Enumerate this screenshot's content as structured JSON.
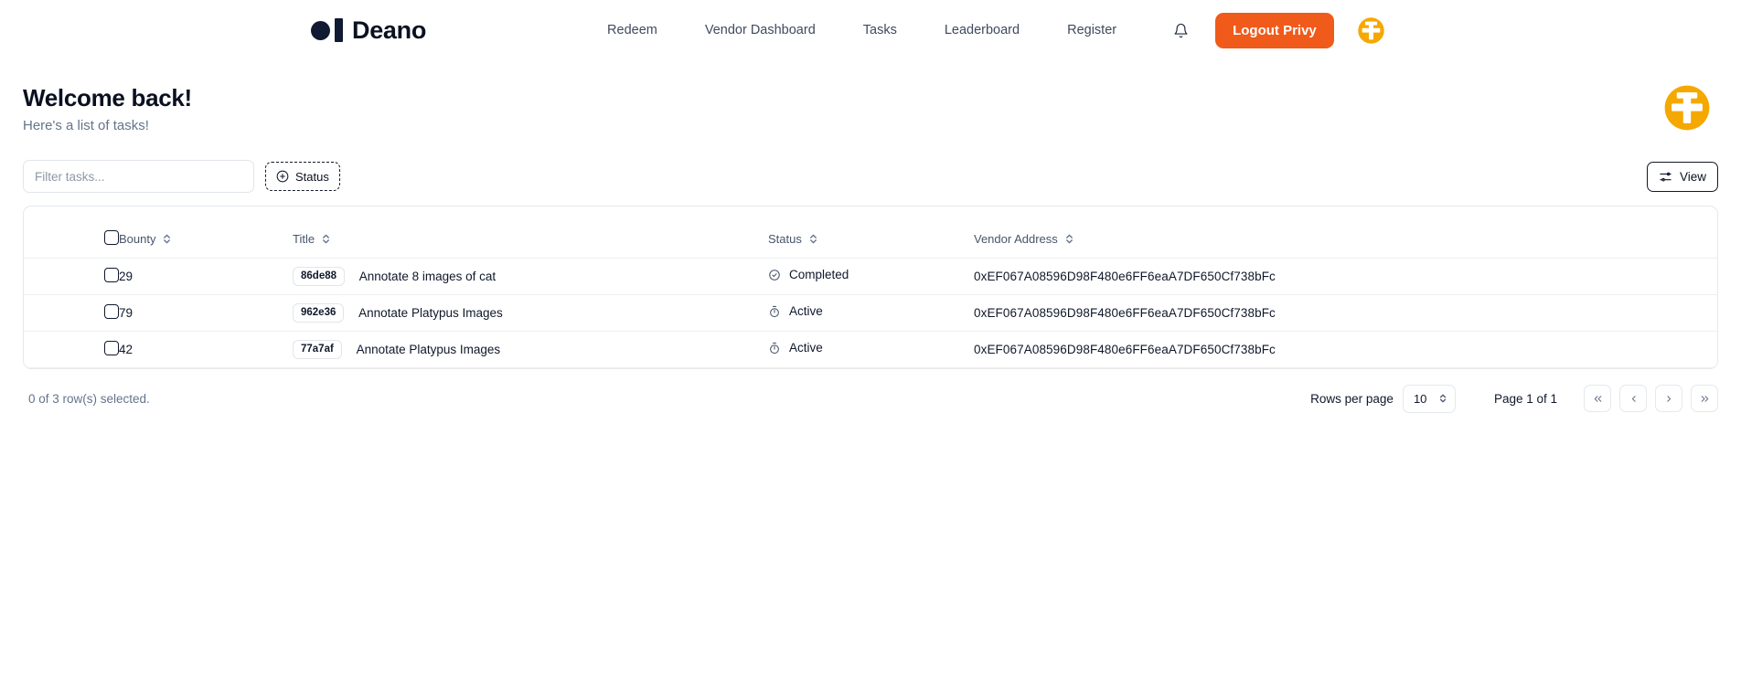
{
  "brand": {
    "name": "Deano"
  },
  "nav": {
    "links": [
      {
        "label": "Redeem"
      },
      {
        "label": "Vendor Dashboard"
      },
      {
        "label": "Tasks"
      },
      {
        "label": "Leaderboard"
      },
      {
        "label": "Register"
      }
    ],
    "logout_label": "Logout Privy",
    "bell_icon": "bell-icon",
    "logo_icon": "anchor-circle-logo"
  },
  "colors": {
    "accent_orange": "#f05a1a",
    "logo_gold": "#f5a800",
    "brand_dark": "#111a33",
    "muted": "#64748b",
    "border": "#e6e8ec"
  },
  "page": {
    "title": "Welcome back!",
    "subtitle": "Here's a list of tasks!"
  },
  "toolbar": {
    "filter_placeholder": "Filter tasks...",
    "filter_value": "",
    "status_label": "Status",
    "status_icon": "plus-circle-icon",
    "view_label": "View",
    "view_icon": "sliders-icon"
  },
  "table": {
    "columns": [
      {
        "key": "bounty",
        "label": "Bounty"
      },
      {
        "key": "title",
        "label": "Title"
      },
      {
        "key": "status",
        "label": "Status"
      },
      {
        "key": "vendor",
        "label": "Vendor Address"
      }
    ],
    "rows": [
      {
        "selected": false,
        "bounty": "29",
        "badge": "86de88",
        "title": "Annotate 8 images of cat",
        "status": "Completed",
        "status_icon": "check-circle-icon",
        "vendor": "0xEF067A08596D98F480e6FF6eaA7DF650Cf738bFc"
      },
      {
        "selected": false,
        "bounty": "79",
        "badge": "962e36",
        "title": "Annotate Platypus Images",
        "status": "Active",
        "status_icon": "timer-icon",
        "vendor": "0xEF067A08596D98F480e6FF6eaA7DF650Cf738bFc"
      },
      {
        "selected": false,
        "bounty": "42",
        "badge": "77a7af",
        "title": "Annotate Platypus Images",
        "status": "Active",
        "status_icon": "timer-icon",
        "vendor": "0xEF067A08596D98F480e6FF6eaA7DF650Cf738bFc"
      }
    ]
  },
  "footer": {
    "rows_selected": "0 of 3 row(s) selected.",
    "rows_per_page_label": "Rows per page",
    "rows_per_page_value": "10",
    "page_label": "Page 1 of 1",
    "first_icon": "chevrons-left-icon",
    "prev_icon": "chevron-left-icon",
    "next_icon": "chevron-right-icon",
    "last_icon": "chevrons-right-icon"
  }
}
